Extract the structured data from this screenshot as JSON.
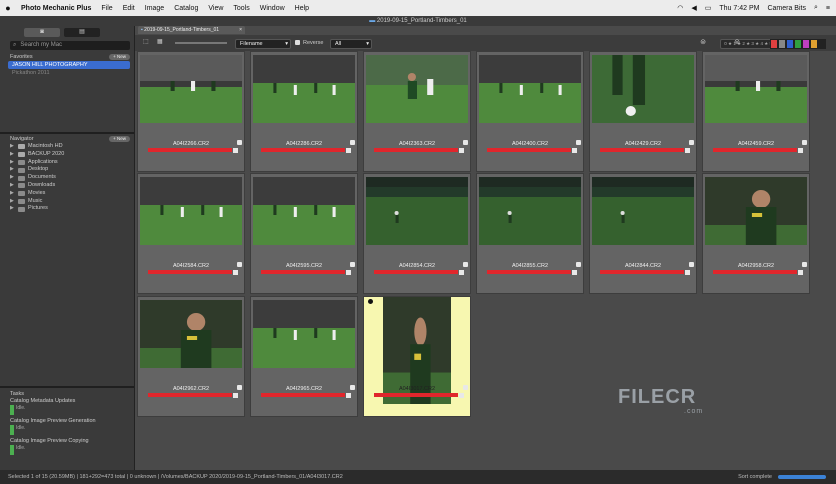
{
  "menubar": {
    "apple": "",
    "items": [
      "Photo Mechanic Plus",
      "File",
      "Edit",
      "Image",
      "Catalog",
      "View",
      "Tools",
      "Window",
      "Help"
    ],
    "clock": "Thu 7:42 PM",
    "user": "Camera Bits"
  },
  "window": {
    "title": "2019-09-15_Portland-Timbers_01"
  },
  "sidebar": {
    "search_placeholder": "Search my Mac",
    "favorites_label": "Favorites",
    "new_label": "+ New",
    "favorites": [
      "JASON HILL PHOTOGRAPHY",
      "Pickathon 2011"
    ],
    "navigator_label": "Navigator",
    "nav_items": [
      "Macintosh HD",
      "BACKUP 2020",
      "Applications",
      "Desktop",
      "Documents",
      "Downloads",
      "Movies",
      "Music",
      "Pictures"
    ],
    "tasks_label": "Tasks",
    "tasks": [
      {
        "name": "Catalog Metadata Updates",
        "status": "Idle."
      },
      {
        "name": "Catalog Image Preview Generation",
        "status": "Idle."
      },
      {
        "name": "Catalog Image Preview Copying",
        "status": "Idle."
      }
    ]
  },
  "main": {
    "tab_label": "2019-09-15_Portland-Timbers_01",
    "sort_field": "Filename",
    "reverse_label": "Reverse",
    "filter": "All",
    "stars_label": "0 ★ 1 ★ 2 ★ 3 ★ 4 ★ 5",
    "color_swatches": [
      "#e04040",
      "#888888",
      "#3060d0",
      "#30a040",
      "#c040c0",
      "#e0a030",
      "#222222"
    ]
  },
  "thumbnails": [
    {
      "file": "A04I2266.CR2",
      "scene": "stadium"
    },
    {
      "file": "A04I2286.CR2",
      "scene": "field"
    },
    {
      "file": "A04I2363.CR2",
      "scene": "player"
    },
    {
      "file": "A04I2400.CR2",
      "scene": "field"
    },
    {
      "file": "A04I2429.CR2",
      "scene": "closeup"
    },
    {
      "file": "A04I2459.CR2",
      "scene": "stadium"
    },
    {
      "file": "A04I2584.CR2",
      "scene": "field"
    },
    {
      "file": "A04I2595.CR2",
      "scene": "field"
    },
    {
      "file": "A04I2854.CR2",
      "scene": "dark"
    },
    {
      "file": "A04I2855.CR2",
      "scene": "dark"
    },
    {
      "file": "A04I2844.CR2",
      "scene": "dark"
    },
    {
      "file": "A04I2958.CR2",
      "scene": "portrait"
    },
    {
      "file": "A04I2962.CR2",
      "scene": "portrait"
    },
    {
      "file": "A04I2965.CR2",
      "scene": "field"
    },
    {
      "file": "A04I3017.CR2",
      "scene": "portrait",
      "selected": true
    }
  ],
  "status": {
    "text": "Selected 1 of 15 (20.59MB) | 181+292=473 total | 0 unknown | /Volumes/BACKUP 2020/2019-09-15_Portland-Timbers_01/A04I3017.CR2",
    "sort": "Sort complete"
  },
  "watermark": {
    "text": "FILECR",
    "sub": ".com"
  }
}
